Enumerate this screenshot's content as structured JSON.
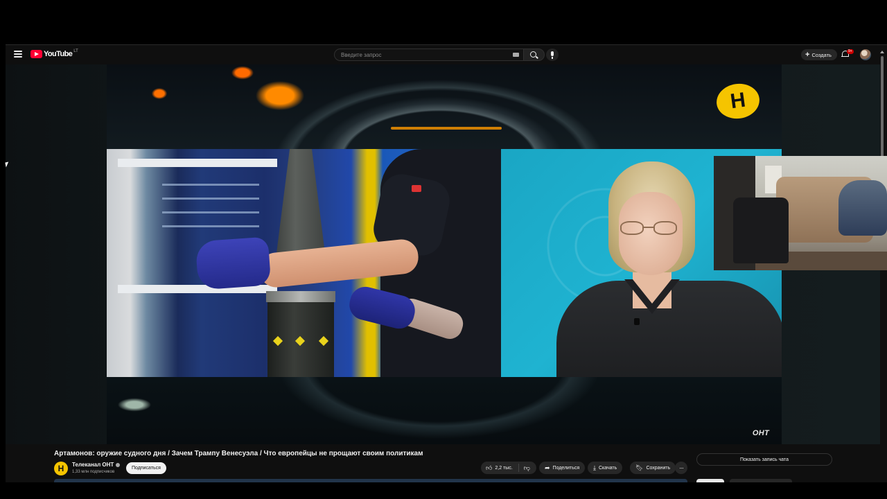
{
  "app": {
    "logo_text": "YouTube",
    "logo_country": "LT",
    "brand_color": "#ff0033"
  },
  "header": {
    "search_placeholder": "Введите запрос",
    "create_label": "Создать",
    "notification_count": "9+",
    "icons": [
      "menu-icon",
      "search-icon",
      "keyboard-icon",
      "mic-icon",
      "plus-icon",
      "bell-icon",
      "avatar"
    ]
  },
  "player": {
    "channel_logo_letter": "Н",
    "watermark": "ОНТ",
    "logo_color": "#f5c400"
  },
  "video": {
    "title": "Артамонов: оружие судного дня / Зачем Трампу Венесуэла / Что европейцы не прощают своим политикам",
    "channel_name": "Телеканал ОНТ",
    "subscribers": "1,33 млн подписчиков",
    "subscribe_label": "Подписаться"
  },
  "actions": {
    "likes": "2,2 тыс.",
    "share_label": "Поделиться",
    "download_label": "Скачать",
    "save_label": "Сохранить",
    "more_label": "···"
  },
  "chat": {
    "show_replay_label": "Показать запись чата"
  }
}
